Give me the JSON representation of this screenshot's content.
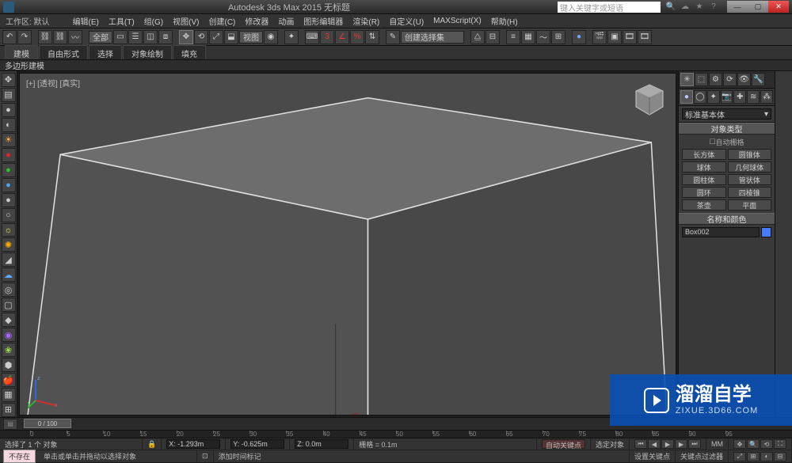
{
  "title": "Autodesk 3ds Max 2015    无标题",
  "workspace": "工作区: 默认",
  "search_placeholder": "键入关键字或短语",
  "menu": [
    "编辑(E)",
    "工具(T)",
    "组(G)",
    "视图(V)",
    "创建(C)",
    "修改器",
    "动画",
    "图形编辑器",
    "渲染(R)",
    "自定义(U)",
    "MAXScript(X)",
    "帮助(H)"
  ],
  "toolbar2": {
    "selset": "全部",
    "view_drop": "视图",
    "render_drop": "创建选择集"
  },
  "ribbon_tabs": [
    "建模",
    "自由形式",
    "选择",
    "对象绘制",
    "填充"
  ],
  "panel_label": "多边形建模",
  "viewport_label": "[+] [透视] [真实]",
  "command_panel": {
    "dropdown": "标准基本体",
    "rollout1": "对象类型",
    "auto_grid": "自动栅格",
    "objects": [
      "长方体",
      "圆锥体",
      "球体",
      "几何球体",
      "圆柱体",
      "管状体",
      "圆环",
      "四棱锥",
      "茶壶",
      "平面"
    ],
    "rollout2": "名称和颜色",
    "name_value": "Box002"
  },
  "timeline": {
    "current": "0 / 100"
  },
  "ruler_ticks": [
    "0",
    "5",
    "10",
    "15",
    "20",
    "25",
    "30",
    "35",
    "40",
    "45",
    "50",
    "55",
    "60",
    "65",
    "70",
    "75",
    "80",
    "85",
    "90",
    "95"
  ],
  "status": {
    "line1_a": "选择了 1 个 对象",
    "line1_x": "X: -1.293m",
    "line1_y": "Y: -0.625m",
    "line1_z": "Z: 0.0m",
    "grid": "栅格 = 0.1m",
    "addtime": "添加时间标记",
    "line2_a": "单击或单击并拖动以选择对象",
    "autokey": "自动关键点",
    "selected_label": "选定对象",
    "setkey": "设置关键点",
    "keyfilter": "关键点过滤器",
    "pink": "不存在",
    "mm": "MM"
  },
  "watermark": {
    "main": "溜溜自学",
    "sub": "ZIXUE.3D66.COM"
  }
}
